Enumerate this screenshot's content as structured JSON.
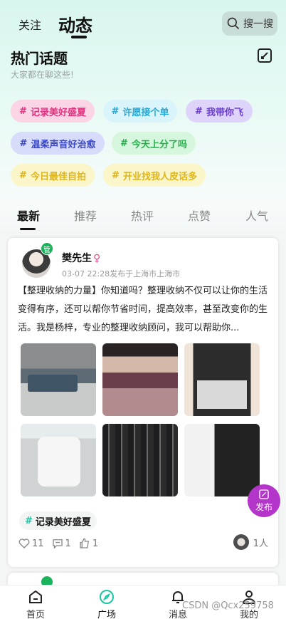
{
  "header": {
    "tab_follow": "关注",
    "tab_dynamic": "动态",
    "search_label": "搜一搜"
  },
  "hot_topics": {
    "title": "热门话题",
    "subtitle": "大家都在聊这些!",
    "tags": [
      {
        "hash": "#",
        "label": "记录美好盛夏"
      },
      {
        "hash": "#",
        "label": "许愿接个单"
      },
      {
        "hash": "#",
        "label": "我带你飞"
      },
      {
        "hash": "#",
        "label": "温柔声音好治愈"
      },
      {
        "hash": "#",
        "label": "今天上分了吗"
      },
      {
        "hash": "#",
        "label": "今日最佳自拍"
      },
      {
        "hash": "#",
        "label": "开业找我人皮话多"
      }
    ]
  },
  "feed_tabs": [
    "最新",
    "推荐",
    "热评",
    "点赞",
    "人气"
  ],
  "post": {
    "badge": "管",
    "author": "樊先生",
    "gender": "♀",
    "meta": "03-07 22:28发布于上海市上海市",
    "text": "【整理收纳的力量】你知道吗？整理收纳不仅可以让你的生活变得有序，还可以帮你节省时间，提高效率，甚至改变你的生活。我是杨梓，专业的整理收纳顾问，我可以帮助你...",
    "tag_hash": "#",
    "tag": "记录美好盛夏",
    "likes": "11",
    "comments": "1",
    "thumbs": "1",
    "viewers": "1人"
  },
  "publish_label": "发布",
  "nav": {
    "home": "首页",
    "square": "广场",
    "messages": "消息",
    "mine": "我的"
  },
  "watermark": "CSDN @Qcx259758",
  "colors": {
    "accent": "#1bc7a3",
    "publish": "#b335c9",
    "badge": "#18b35a"
  }
}
